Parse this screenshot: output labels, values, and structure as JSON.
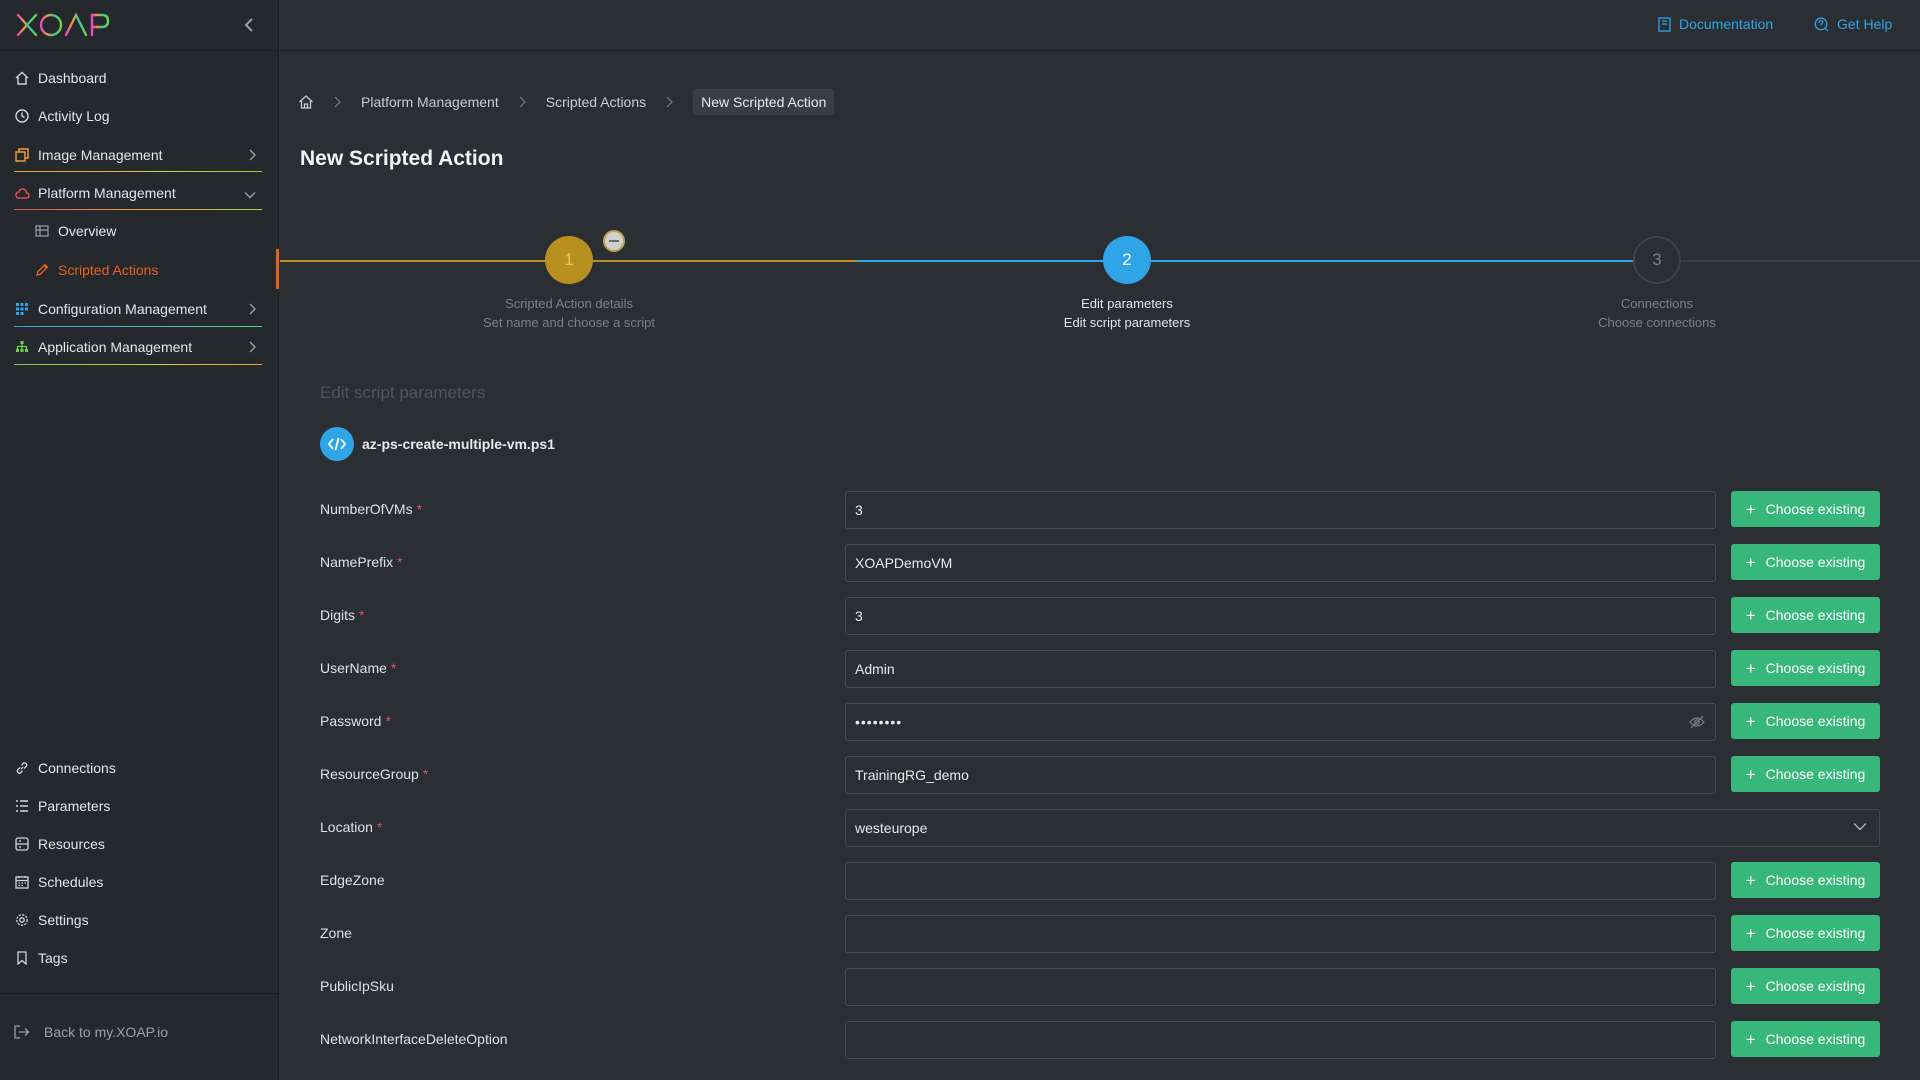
{
  "brand": {
    "logo_text": "XOAP"
  },
  "sidebar": {
    "items": [
      {
        "label": "Dashboard",
        "icon": "home-icon"
      },
      {
        "label": "Activity Log",
        "icon": "clock-icon"
      },
      {
        "label": "Image Management",
        "icon": "image-stack-icon"
      },
      {
        "label": "Platform Management",
        "icon": "cloud-icon"
      },
      {
        "label": "Configuration Management",
        "icon": "grid-icon"
      },
      {
        "label": "Application Management",
        "icon": "hierarchy-icon"
      }
    ],
    "sub_items": [
      {
        "label": "Overview",
        "icon": "table-icon"
      },
      {
        "label": "Scripted Actions",
        "icon": "pencil-icon"
      }
    ],
    "bottom_items": [
      {
        "label": "Connections",
        "icon": "link-icon"
      },
      {
        "label": "Parameters",
        "icon": "list-icon"
      },
      {
        "label": "Resources",
        "icon": "stack-icon"
      },
      {
        "label": "Schedules",
        "icon": "calendar-icon"
      },
      {
        "label": "Settings",
        "icon": "gear-icon"
      },
      {
        "label": "Tags",
        "icon": "bookmark-icon"
      }
    ],
    "back_link": "Back to my.XOAP.io"
  },
  "topbar": {
    "documentation": "Documentation",
    "get_help": "Get Help"
  },
  "breadcrumb": [
    "Platform Management",
    "Scripted Actions",
    "New Scripted Action"
  ],
  "page_title": "New Scripted Action",
  "stepper": {
    "steps": [
      {
        "number": "1",
        "title": "Scripted Action details",
        "subtitle": "Set name and choose a script"
      },
      {
        "number": "2",
        "title": "Edit parameters",
        "subtitle": "Edit script parameters"
      },
      {
        "number": "3",
        "title": "Connections",
        "subtitle": "Choose connections"
      }
    ]
  },
  "form": {
    "section_title": "Edit script parameters",
    "script_name": "az-ps-create-multiple-vm.ps1",
    "choose_label": "Choose existing",
    "required_mark": "*",
    "fields": [
      {
        "label": "NumberOfVMs",
        "value": "3",
        "required": true
      },
      {
        "label": "NamePrefix",
        "value": "XOAPDemoVM",
        "required": true
      },
      {
        "label": "Digits",
        "value": "3",
        "required": true
      },
      {
        "label": "UserName",
        "value": "Admin",
        "required": true
      },
      {
        "label": "Password",
        "value": "••••••••",
        "required": true
      },
      {
        "label": "ResourceGroup",
        "value": "TrainingRG_demo",
        "required": true
      },
      {
        "label": "Location",
        "value": "westeurope",
        "required": true
      },
      {
        "label": "EdgeZone",
        "value": "",
        "required": false
      },
      {
        "label": "Zone",
        "value": "",
        "required": false
      },
      {
        "label": "PublicIpSku",
        "value": "",
        "required": false
      },
      {
        "label": "NetworkInterfaceDeleteOption",
        "value": "",
        "required": false
      }
    ]
  },
  "colors": {
    "accent_blue": "#2fa4e7",
    "accent_gold": "#c49a1f",
    "accent_green": "#38b77a",
    "active_orange": "#e7621f"
  }
}
